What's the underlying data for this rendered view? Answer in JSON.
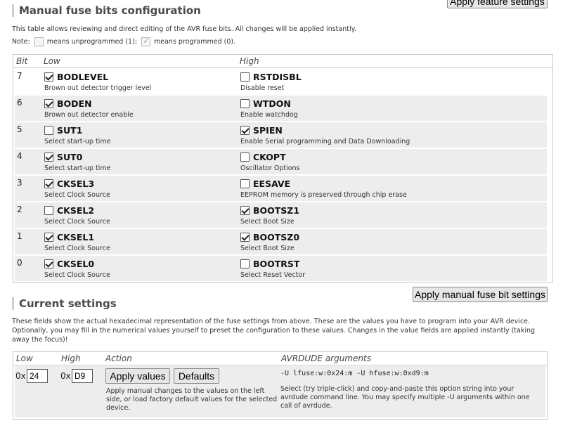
{
  "buttons": {
    "apply_feature": "Apply feature settings",
    "apply_manual": "Apply manual fuse bit settings",
    "apply_values": "Apply values",
    "defaults": "Defaults"
  },
  "manual": {
    "title": "Manual fuse bits configuration",
    "intro": "This table allows reviewing and direct editing of the AVR fuse bits. All changes will be applied instantly.",
    "note_label": "Note:",
    "note_unprog": "means unprogrammed (1);",
    "note_prog": "means programmed (0)."
  },
  "fuse_table": {
    "headers": {
      "bit": "Bit",
      "low": "Low",
      "high": "High"
    },
    "rows": [
      {
        "bit": "7",
        "low": {
          "name": "BODLEVEL",
          "desc": "Brown out detector trigger level",
          "checked": true
        },
        "high": {
          "name": "RSTDISBL",
          "desc": "Disable reset",
          "checked": false
        }
      },
      {
        "bit": "6",
        "low": {
          "name": "BODEN",
          "desc": "Brown out detector enable",
          "checked": true
        },
        "high": {
          "name": "WTDON",
          "desc": "Enable watchdog",
          "checked": false
        }
      },
      {
        "bit": "5",
        "low": {
          "name": "SUT1",
          "desc": "Select start-up time",
          "checked": false
        },
        "high": {
          "name": "SPIEN",
          "desc": "Enable Serial programming and Data Downloading",
          "checked": true
        }
      },
      {
        "bit": "4",
        "low": {
          "name": "SUT0",
          "desc": "Select start-up time",
          "checked": true
        },
        "high": {
          "name": "CKOPT",
          "desc": "Oscillator Options",
          "checked": false
        }
      },
      {
        "bit": "3",
        "low": {
          "name": "CKSEL3",
          "desc": "Select Clock Source",
          "checked": true
        },
        "high": {
          "name": "EESAVE",
          "desc": "EEPROM memory is preserved through chip erase",
          "checked": false
        }
      },
      {
        "bit": "2",
        "low": {
          "name": "CKSEL2",
          "desc": "Select Clock Source",
          "checked": false
        },
        "high": {
          "name": "BOOTSZ1",
          "desc": "Select Boot Size",
          "checked": true
        }
      },
      {
        "bit": "1",
        "low": {
          "name": "CKSEL1",
          "desc": "Select Clock Source",
          "checked": true
        },
        "high": {
          "name": "BOOTSZ0",
          "desc": "Select Boot Size",
          "checked": true
        }
      },
      {
        "bit": "0",
        "low": {
          "name": "CKSEL0",
          "desc": "Select Clock Source",
          "checked": true
        },
        "high": {
          "name": "BOOTRST",
          "desc": "Select Reset Vector",
          "checked": false
        }
      }
    ]
  },
  "current": {
    "title": "Current settings",
    "intro_1": "These fields show the actual hexadecimal representation of the fuse settings from above. These are the values you have to program into your AVR device.",
    "intro_2": "Optionally, you may fill in the numerical values yourself to preset the configuration to these values. Changes in the value fields are applied instantly (taking",
    "intro_3": "away the focus)!",
    "headers": {
      "low": "Low",
      "high": "High",
      "action": "Action",
      "avrdude": "AVRDUDE arguments"
    },
    "hex_prefix": "0x",
    "low_value": "24",
    "high_value": "D9",
    "action_help_1": "Apply manual changes to the values on the left",
    "action_help_2": "side, or load factory default values for the selected",
    "action_help_3": "device.",
    "avrdude_args": "-U lfuse:w:0x24:m -U hfuse:w:0xd9:m",
    "avrdude_help_1": "Select (try triple-click) and copy-and-paste this option string into your",
    "avrdude_help_2": "avrdude command line. You may specify multiple -U arguments within one",
    "avrdude_help_3": "call of avrdude."
  }
}
